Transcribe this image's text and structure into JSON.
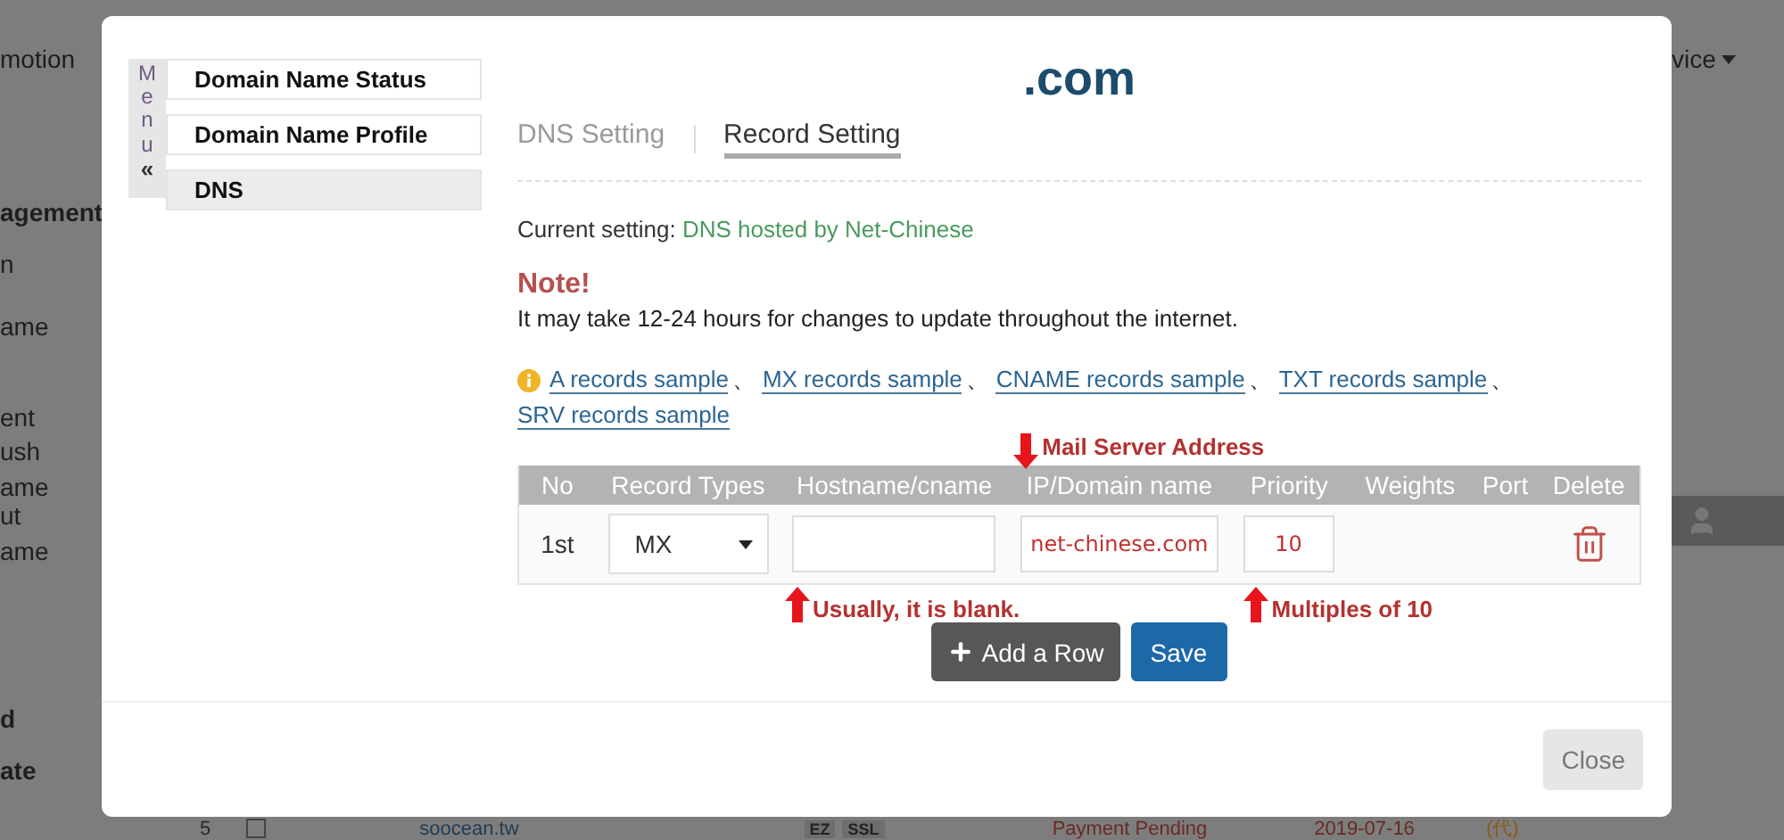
{
  "background": {
    "left_column": [
      {
        "text": "motion",
        "kind": "menu"
      },
      {
        "text": "agement",
        "kind": "heading"
      },
      {
        "text": "n",
        "kind": "item"
      },
      {
        "text": "ame",
        "kind": "item"
      },
      {
        "text": "ent",
        "kind": "item"
      },
      {
        "text": "ush",
        "kind": "item"
      },
      {
        "text": "ame",
        "kind": "item"
      },
      {
        "text": "ut",
        "kind": "item"
      },
      {
        "text": "ame",
        "kind": "item"
      },
      {
        "text": "d",
        "kind": "heading"
      },
      {
        "text": "ate",
        "kind": "heading"
      }
    ],
    "right_menu": "vice",
    "bottom_row": {
      "no": "5",
      "domain": "soocean.tw",
      "tags": [
        "EZ",
        "SSL"
      ],
      "status": "Payment Pending",
      "date": "2019-07-16",
      "mark": "(代)",
      "checked": false
    }
  },
  "dialog": {
    "sidebar": {
      "menu_label": "Menu",
      "collapse": "«",
      "items": [
        {
          "label": "Domain Name Status",
          "selected": false
        },
        {
          "label": "Domain Name Profile",
          "selected": false
        },
        {
          "label": "DNS",
          "selected": true
        }
      ]
    },
    "title": ".com",
    "tabs": [
      {
        "label": "DNS Setting",
        "selected": false
      },
      {
        "label": "Record Setting",
        "selected": true
      }
    ],
    "current_setting": {
      "label": "Current setting:",
      "value": "DNS hosted by Net-Chinese"
    },
    "note": {
      "title": "Note!",
      "text": "It may take 12-24 hours for changes to update throughout the internet."
    },
    "samples": [
      {
        "label": "A records sample",
        "separator": "、"
      },
      {
        "label": "MX records sample",
        "separator": "、"
      },
      {
        "label": "CNAME records sample",
        "separator": "、"
      },
      {
        "label": "TXT records sample",
        "separator": "、"
      },
      {
        "label": "SRV records sample"
      }
    ],
    "table": {
      "columns": [
        "No",
        "Record Types",
        "Hostname/cname",
        "IP/Domain name",
        "Priority",
        "Weights",
        "Port",
        "Delete"
      ],
      "rows": [
        {
          "no": "1st",
          "record_type": "MX",
          "hostname": {
            "note": {
              "text": "Usually, it is blank.",
              "kind": "below"
            }
          },
          "ip": {
            "value": "net-chinese.com",
            "note": {
              "text": "Mail Server Address",
              "kind": "above"
            }
          },
          "priority": {
            "value": "10",
            "note": {
              "text": "Multiples of 10",
              "kind": "below"
            }
          }
        }
      ]
    },
    "buttons": [
      {
        "label": "Add a Row",
        "kind": "add"
      },
      {
        "label": "Save",
        "kind": "primary"
      }
    ],
    "close": "Close"
  }
}
